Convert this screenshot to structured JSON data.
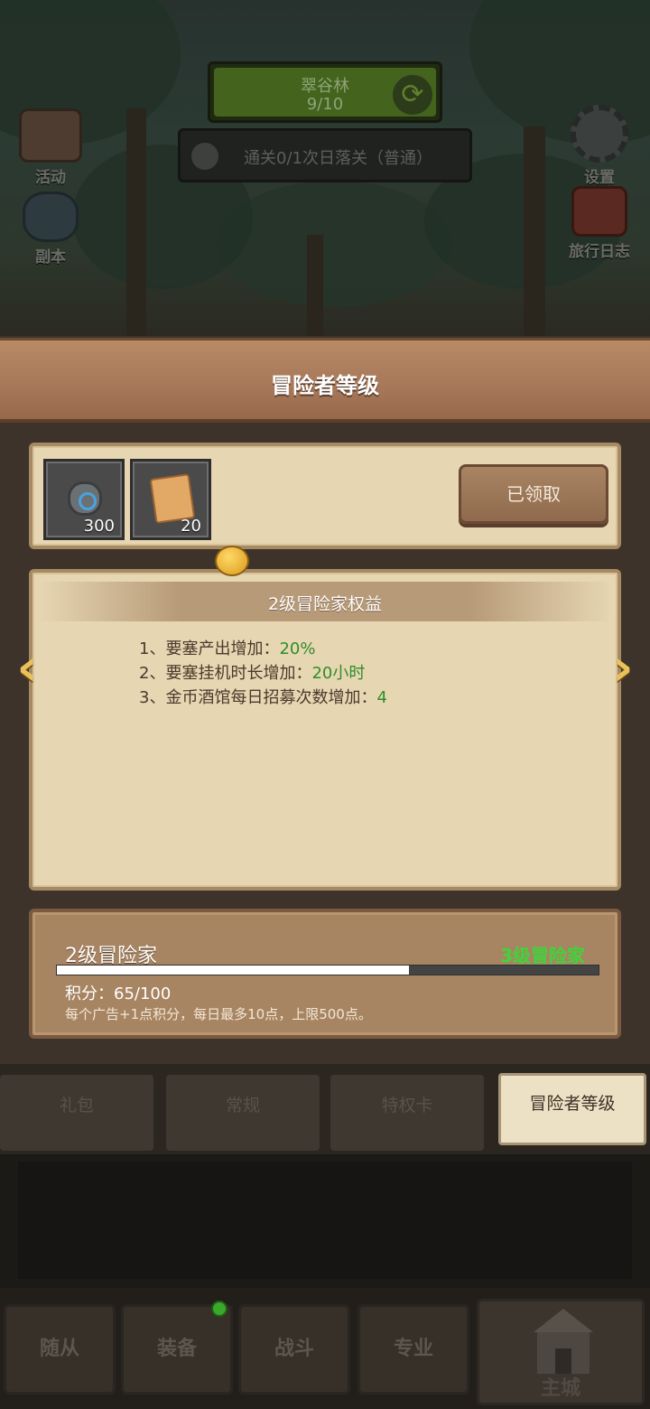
{
  "scene": {
    "stage": {
      "name": "翠谷林",
      "progress": "9/10"
    },
    "quest": {
      "text": "通关0/1次日落关（普通）"
    },
    "left_buttons": [
      {
        "label": "活动",
        "icon": "scroll-book-icon"
      },
      {
        "label": "副本",
        "icon": "portal-icon"
      }
    ],
    "right_buttons": [
      {
        "label": "设置",
        "icon": "gear-icon"
      },
      {
        "label": "旅行日志",
        "icon": "journal-icon"
      }
    ]
  },
  "panel": {
    "title": "冒险者等级",
    "reward": {
      "items": [
        {
          "icon": "gem-icon",
          "qty": "300"
        },
        {
          "icon": "scroll-icon",
          "qty": "20"
        }
      ],
      "claim_label": "已领取"
    },
    "benefits": {
      "title": "2级冒险家权益",
      "lines": [
        {
          "text": "1、要塞产出增加：",
          "value": "20%"
        },
        {
          "text": "2、要塞挂机时长增加：",
          "value": "20小时"
        },
        {
          "text": "3、金币酒馆每日招募次数增加：",
          "value": "4"
        }
      ]
    },
    "level": {
      "current": "2级冒险家",
      "next": "3级冒险家",
      "points_text": "积分：65/100",
      "progress_fraction": 0.65,
      "hint": "每个广告+1点积分，每日最多10点，上限500点。"
    }
  },
  "tabs": [
    "礼包",
    "常规",
    "特权卡",
    "冒险者等级"
  ],
  "active_tab": "冒险者等级",
  "nav": {
    "items": [
      "随从",
      "装备",
      "战斗",
      "专业"
    ],
    "home": "主城"
  },
  "colors": {
    "accent_green": "#3fd43a",
    "value_green": "#2f8d2a",
    "parchment": "#e7d6b2",
    "wood": "#a88562"
  }
}
